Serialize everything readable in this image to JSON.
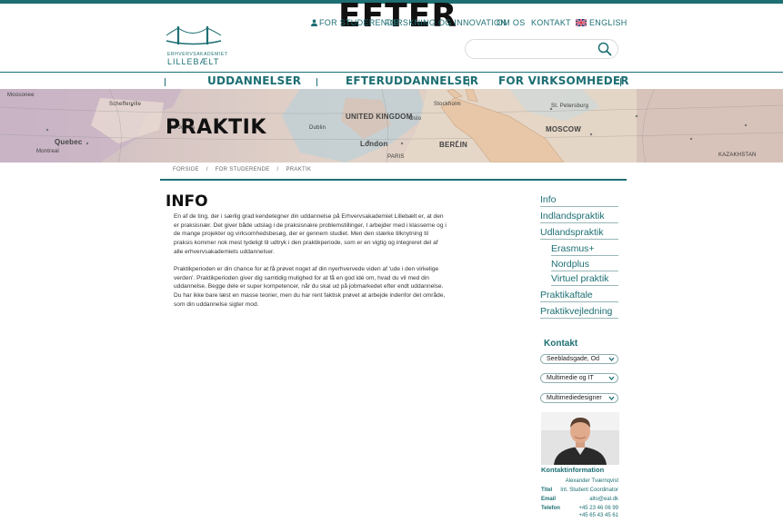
{
  "overlay": {
    "stamp": "EFTER"
  },
  "brand": {
    "line1": "ERHVERVSAKADEMIET",
    "line2": "LILLEBÆLT"
  },
  "topnav": {
    "students": "FOR STUDERENDE",
    "research": "FORSKNING OG INNOVATION",
    "about": "OM OS",
    "contact": "KONTAKT",
    "language": "ENGLISH"
  },
  "search": {
    "placeholder": ""
  },
  "mainnav": [
    "UDDANNELSER",
    "EFTERUDDANNELSER",
    "FOR VIRKSOMHEDER"
  ],
  "hero": {
    "title": "PRAKTIK",
    "map_labels": [
      "Moosonee",
      "Schefferville",
      "Quebec",
      "Montreal",
      "St. John's",
      "UNITED KINGDOM",
      "London",
      "PARIS",
      "BERLIN",
      "MOSCOW",
      "St. Petersburg",
      "Stockholm",
      "KAZAKHSTAN",
      "Oslo",
      "Dublin"
    ]
  },
  "breadcrumb": [
    "FORSIDE",
    "/",
    "FOR STUDERENDE",
    "/",
    "PRAKTIK"
  ],
  "content": {
    "heading": "INFO",
    "p1": "En af de ting, der i særlig grad kendetegner din uddannelse på Erhvervsakademiet Lillebælt er, at den er praksisnær. Det giver både udslag i de praksisnære problemstillinger, I arbejder med i klasserne og i de mange projekter og virksomhedsbesøg, der er gennem studiet. Men den stærke tilknytning til praksis kommer nok mest tydeligt til udtryk i den praktikperiode, som er en vigtig og integreret del af alle erhvervsakademiets uddannelser.",
    "p2": "Praktikperioden er din chance for at få prøvet noget af din nyerhvervede viden af 'ude i den virkelige verden'. Praktikperioden giver dig samtidig mulighed for at få en god idé om, hvad du vil med din uddannelse. Begge dele er super kompetencer, når du skal ud på jobmarkedet efter endt uddannelse. Du har ikke bare læst en masse teorier, men du har rent faktisk prøvet at arbejde indenfor det område, som din uddannelse sigter mod."
  },
  "sidenav": {
    "info": "Info",
    "indland": "Indlandspraktik",
    "udland": "Udlandspraktik",
    "erasmus": "Erasmus+",
    "nordplus": "Nordplus",
    "virtuel": "Virtuel praktik",
    "aftale": "Praktikaftale",
    "vejledning": "Praktikvejledning"
  },
  "contact": {
    "title": "Kontakt",
    "dropdowns": [
      "Seebladsgade, Od",
      "Multimedie og IT",
      "Multimediedesigner"
    ],
    "info_title": "Kontaktinformation",
    "name": "Alexander Tværnqvist",
    "title_label": "Titel",
    "title_value": "Int. Student Coordinator",
    "email_label": "Email",
    "email_value": "alto@eal.dk",
    "phone_label": "Telefon",
    "phone1": "+45 23 46 06 99",
    "phone2": "+45 65 43 45 61"
  },
  "colors": {
    "accent": "#1d6f73",
    "text": "#333333"
  }
}
